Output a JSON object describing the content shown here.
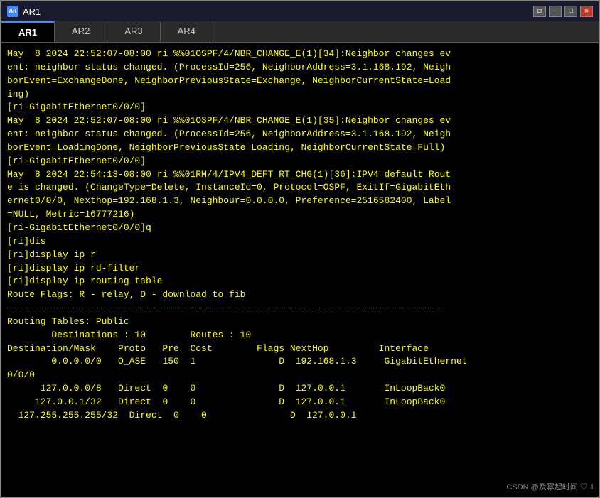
{
  "titleBar": {
    "title": "AR1",
    "icon": "AR",
    "controls": [
      "restore",
      "minimize",
      "maximize",
      "close"
    ]
  },
  "tabs": [
    {
      "label": "AR1",
      "active": true
    },
    {
      "label": "AR2",
      "active": false
    },
    {
      "label": "AR3",
      "active": false
    },
    {
      "label": "AR4",
      "active": false
    }
  ],
  "terminal": {
    "lines": [
      "May  8 2024 22:52:07-08:00 ri %%01OSPF/4/NBR_CHANGE_E(1)[34]:Neighbor changes ev",
      "ent: neighbor status changed. (ProcessId=256, NeighborAddress=3.1.168.192, Neigh",
      "borEvent=ExchangeDone, NeighborPreviousState=Exchange, NeighborCurrentState=Load",
      "ing)",
      "[ri-GigabitEthernet0/0/0]",
      "May  8 2024 22:52:07-08:00 ri %%01OSPF/4/NBR_CHANGE_E(1)[35]:Neighbor changes ev",
      "ent: neighbor status changed. (ProcessId=256, NeighborAddress=3.1.168.192, Neigh",
      "borEvent=LoadingDone, NeighborPreviousState=Loading, NeighborCurrentState=Full)",
      "",
      "[ri-GigabitEthernet0/0/0]",
      "May  8 2024 22:54:13-08:00 ri %%01RM/4/IPV4_DEFT_RT_CHG(1)[36]:IPV4 default Rout",
      "e is changed. (ChangeType=Delete, InstanceId=0, Protocol=OSPF, ExitIf=GigabitEth",
      "ernet0/0/0, Nexthop=192.168.1.3, Neighbour=0.0.0.0, Preference=2516582400, Label",
      "=NULL, Metric=16777216)",
      "[ri-GigabitEthernet0/0/0]q",
      "[ri]dis",
      "[ri]display ip r",
      "[ri]display ip rd-filter",
      "[ri]display ip routing-table",
      "Route Flags: R - relay, D - download to fib",
      "-------------------------------------------------------------------------------",
      "Routing Tables: Public",
      "        Destinations : 10        Routes : 10",
      "",
      "Destination/Mask    Proto   Pre  Cost        Flags NextHop         Interface",
      "",
      "        0.0.0.0/0   O_ASE   150  1               D  192.168.1.3     GigabitEthernet",
      "0/0/0",
      "      127.0.0.0/8   Direct  0    0               D  127.0.0.1       InLoopBack0",
      "     127.0.0.1/32   Direct  0    0               D  127.0.0.1       InLoopBack0",
      "  127.255.255.255/32  Direct  0    0               D  127.0.0.1"
    ]
  },
  "watermark": "CSDN @及幂起时间 ♡ 1"
}
